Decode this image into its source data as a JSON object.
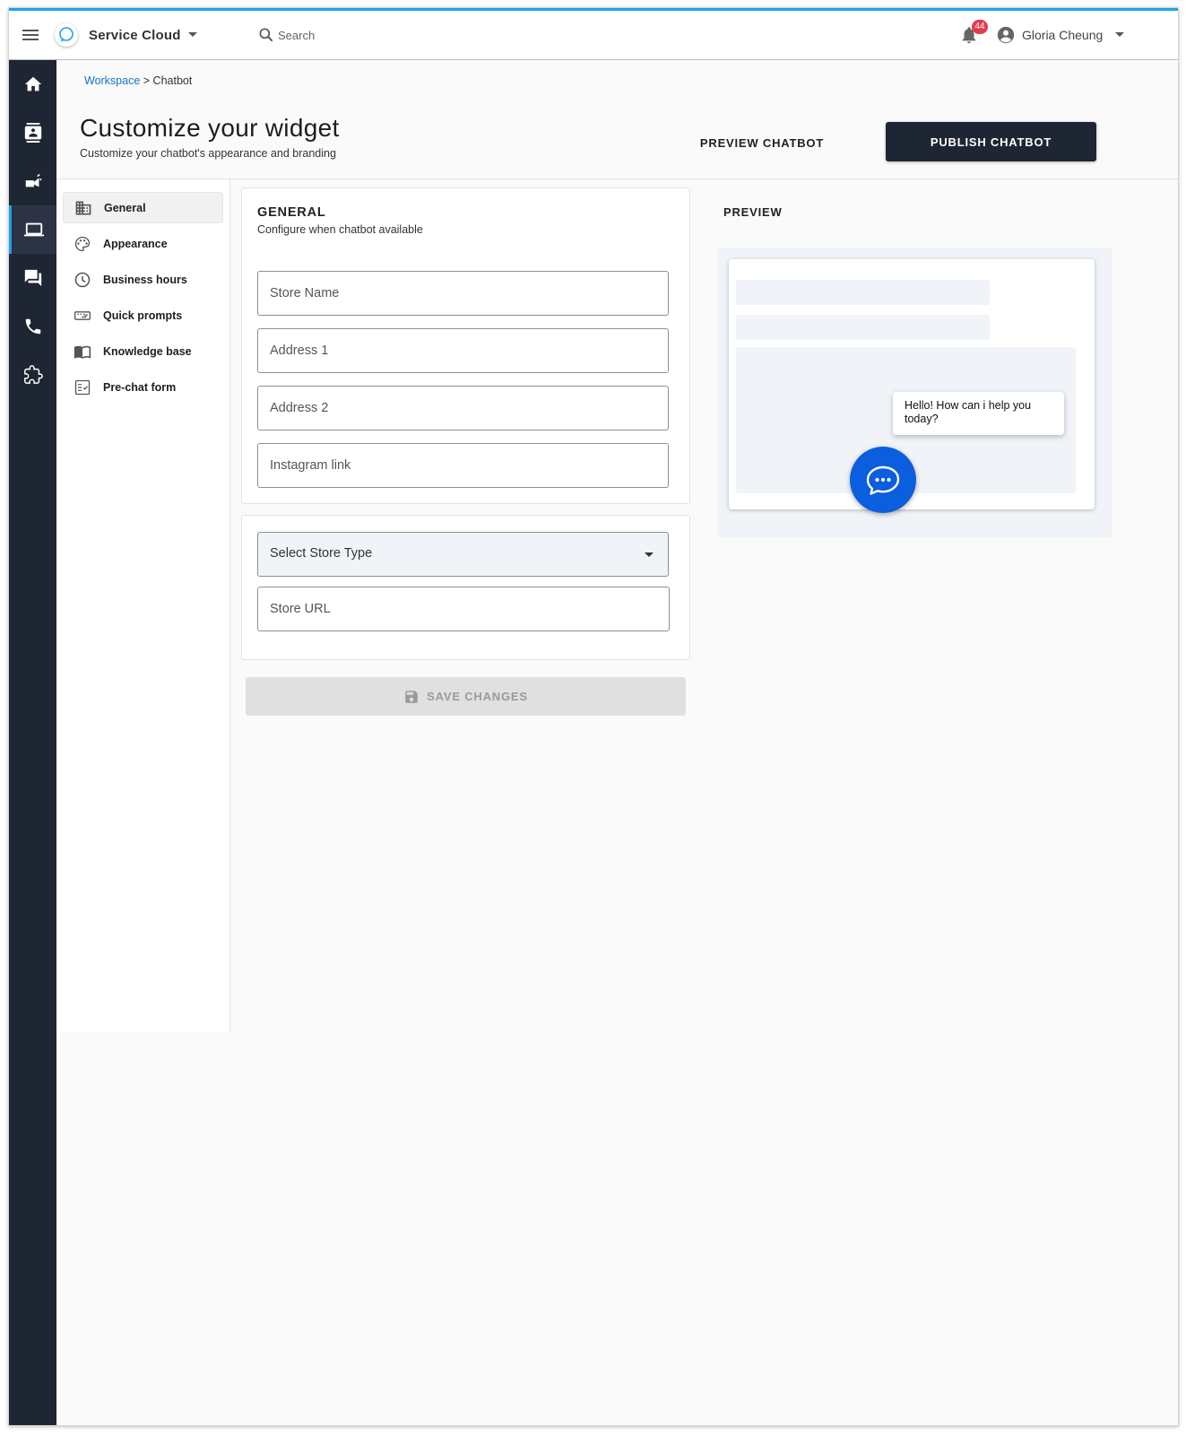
{
  "topbar": {
    "app_name": "Service Cloud",
    "search_placeholder": "Search",
    "notification_count": "44",
    "user_name": "Gloria Cheung"
  },
  "rail": {
    "items": [
      "home-icon",
      "contacts-icon",
      "campaign-icon",
      "laptop-icon",
      "chat-icon",
      "phone-icon",
      "puzzle-icon"
    ],
    "active": "laptop-icon"
  },
  "breadcrumb": {
    "root": "Workspace",
    "separator": " > ",
    "current": "Chatbot"
  },
  "header": {
    "title": "Customize your widget",
    "subtitle": "Customize your chatbot's appearance and branding",
    "preview_button": "PREVIEW CHATBOT",
    "publish_button": "PUBLISH CHATBOT"
  },
  "subnav": {
    "items": [
      {
        "label": "General",
        "icon": "building-icon"
      },
      {
        "label": "Appearance",
        "icon": "palette-icon"
      },
      {
        "label": "Business hours",
        "icon": "clock-icon"
      },
      {
        "label": "Quick prompts",
        "icon": "keyboard-icon"
      },
      {
        "label": "Knowledge base",
        "icon": "book-icon"
      },
      {
        "label": "Pre-chat form",
        "icon": "checklist-icon"
      }
    ],
    "active": "General"
  },
  "general": {
    "title": "GENERAL",
    "subtitle": "Configure when chatbot available",
    "fields": [
      {
        "placeholder": "Store Name",
        "value": ""
      },
      {
        "placeholder": "Address 1",
        "value": ""
      },
      {
        "placeholder": "Address 2",
        "value": ""
      },
      {
        "placeholder": "Instagram link",
        "value": ""
      }
    ]
  },
  "store": {
    "select_value": "Select Store Type",
    "url_placeholder": "Store URL"
  },
  "save_button": "SAVE CHANGES",
  "preview": {
    "label": "PREVIEW",
    "bubble_text": "Hello! How can i help you today?"
  },
  "colors": {
    "accent": "#1aa3e8",
    "rail": "#1f2633",
    "primary_button": "#1f2633",
    "chat_button": "#0b5ede",
    "badge": "#e53950",
    "link": "#1273c9"
  }
}
